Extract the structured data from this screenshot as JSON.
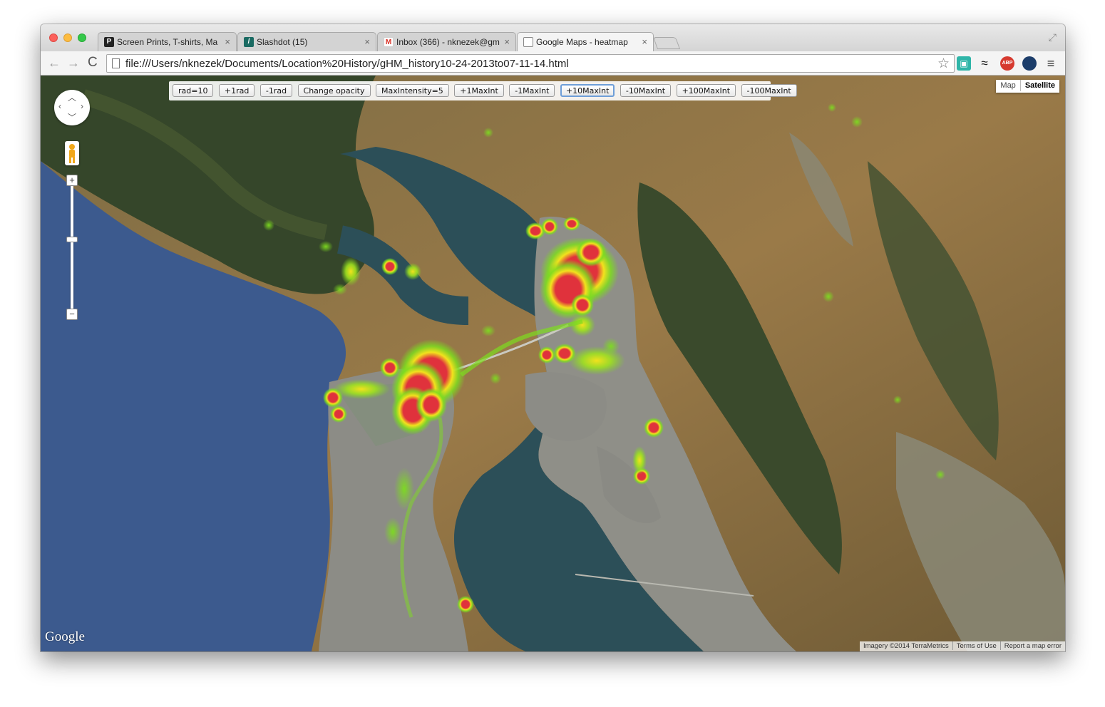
{
  "browser": {
    "tabs": [
      {
        "label": "Screen Prints, T-shirts, Ma",
        "favicon": "P",
        "close": "×"
      },
      {
        "label": "Slashdot (15)",
        "favicon": "/",
        "close": "×"
      },
      {
        "label": "Inbox (366) - nknezek@gm",
        "favicon": "M",
        "close": "×"
      },
      {
        "label": "Google Maps - heatmap",
        "favicon": "",
        "close": "×"
      }
    ],
    "nav": {
      "back": "←",
      "forward": "→",
      "reload": "C"
    },
    "url": "file:///Users/nknezek/Documents/Location%20History/gHM_history10-24-2013to07-11-14.html",
    "star": "☆",
    "extensions": {
      "wave": "≈",
      "abp": "ABP",
      "menu": "≡"
    }
  },
  "map": {
    "buttons": [
      {
        "label": "rad=10"
      },
      {
        "label": "+1rad"
      },
      {
        "label": "-1rad"
      },
      {
        "label": "Change opacity"
      },
      {
        "label": "MaxIntensity=5"
      },
      {
        "label": "+1MaxInt"
      },
      {
        "label": "-1MaxInt"
      },
      {
        "label": "+10MaxInt"
      },
      {
        "label": "-10MaxInt"
      },
      {
        "label": "+100MaxInt"
      },
      {
        "label": "-100MaxInt"
      }
    ],
    "map_type": {
      "map": "Map",
      "satellite": "Satellite",
      "selected": "Satellite"
    },
    "zoom": {
      "plus": "+",
      "minus": "−"
    },
    "logo": "Google",
    "attribution": [
      "Imagery ©2014 TerraMetrics",
      "Terms of Use",
      "Report a map error"
    ],
    "colors": {
      "water": "#2c4f58",
      "ocean": "#3c5a8e",
      "hills": "#8a6e3e",
      "forest": "#35462a",
      "urban": "#8c8c86",
      "heat_low": "#7ddc1f",
      "heat_mid": "#f2e21d",
      "heat_high": "#e0323c"
    }
  }
}
